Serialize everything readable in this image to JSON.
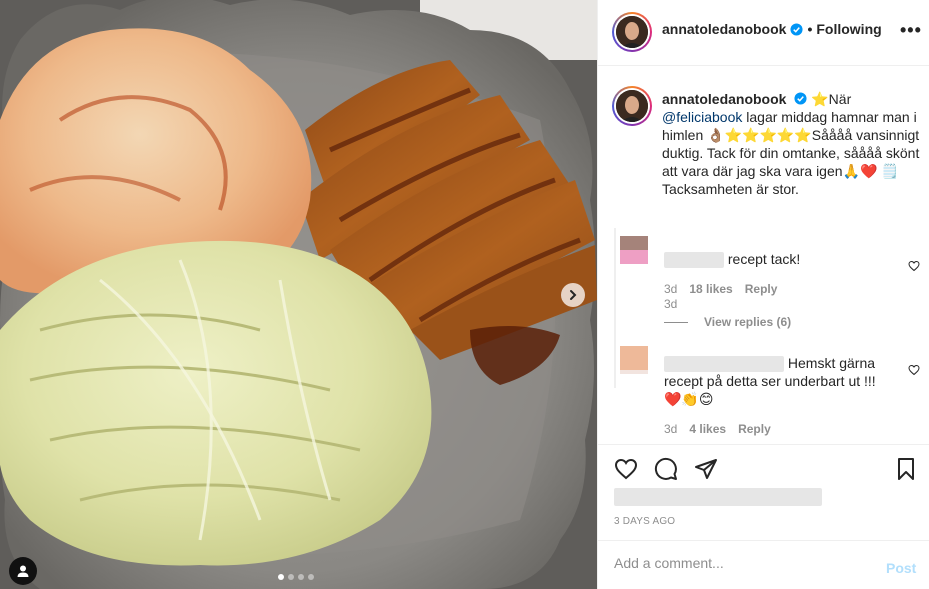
{
  "post": {
    "username": "annatoledanobook",
    "verified_icon": "verified-badge-icon",
    "separator": "•",
    "follow_state": "Following",
    "more_icon": "more-options-icon",
    "more_label": "•••"
  },
  "caption": {
    "username": "annatoledanobook",
    "text_1": "När",
    "mention": "@feliciabook",
    "text_2": "lagar middag hamnar man i himlen",
    "text_3": "Såååå vansinnigt duktig. Tack för din omtanke, såååå skönt att vara där jag ska vara igen",
    "text_4": "Tacksamheten är stor.",
    "time": "3d"
  },
  "comments": [
    {
      "text": "recept tack!",
      "time": "3d",
      "likes": "18 likes",
      "reply_label": "Reply",
      "view_replies": "View replies (6)"
    },
    {
      "text": "Hemskt gärna recept på detta ser underbart ut !!!",
      "time": "3d",
      "likes": "4 likes",
      "reply_label": "Reply"
    }
  ],
  "actions": {
    "like_icon": "heart-icon",
    "comment_icon": "comment-bubble-icon",
    "share_icon": "share-paper-plane-icon",
    "save_icon": "bookmark-icon"
  },
  "posted_date": "3 DAYS AGO",
  "comment_box": {
    "placeholder": "Add a comment...",
    "post_label": "Post"
  },
  "colors": {
    "link": "#00376b",
    "verified": "#0095f6",
    "muted": "#8e8e8e",
    "post_disabled": "#b2dffc"
  },
  "carousel": {
    "slide_count": 4,
    "active_slide": 1
  }
}
